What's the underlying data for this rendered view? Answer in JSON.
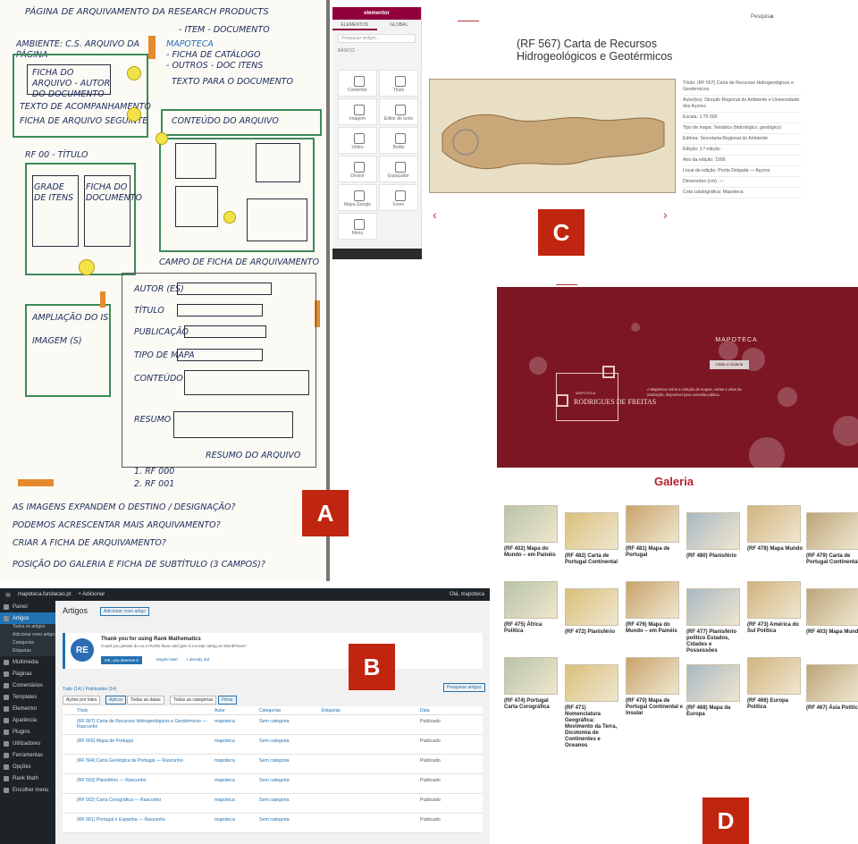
{
  "panel_letters": {
    "a": "A",
    "b": "B",
    "c": "C",
    "d": "D"
  },
  "colors": {
    "accent_red": "#c0260f",
    "mapoteca_bg": "#7d1623",
    "galeria_title": "#b2222c",
    "wp_dark": "#1d2327",
    "wp_blue": "#2271b1",
    "elementor_header": "#92003b",
    "sketch_green": "#3c8a5a",
    "sketch_orange": "#e58a2c"
  },
  "sketch": {
    "t1": "PÁGINA DE ARQUIVAMENTO DA RESEARCH PRODUCTS",
    "t2": "- ITEM - DOCUMENTO",
    "t3": "AMBIENTE: C.S. ARQUIVO DA PÁGINA",
    "t4": "MAPOTECA",
    "t5": "- FICHA DE CATÁLOGO",
    "t6": "- OUTROS - DOC ITENS",
    "t7": "FICHA DO ARQUIVO - AUTOR DO DOCUMENTO",
    "t8": "TEXTO DE ACOMPANHAMENTO",
    "t9": "FICHA DE ARQUIVO SEGUINTE",
    "t10": "TEXTO PARA O DOCUMENTO",
    "t11": "RF 00 - TÍTULO",
    "t12": "GRADE DE ITENS",
    "t13": "FICHA DO DOCUMENTO",
    "t14": "CONTEÚDO DO ARQUIVO",
    "t15": "AMPLIAÇÃO DO IS",
    "t16": "IMAGEM (S)",
    "t17": "AUTOR (ES)",
    "t18": "TÍTULO",
    "t19": "PUBLICAÇÃO",
    "t20": "TIPO DE MAPA",
    "t21": "CONTEÚDO",
    "t22": "RESUMO",
    "t23": "CAMPO DE FICHA DE ARQUIVAMENTO",
    "t24": "1. RF 000",
    "t25": "2. RF 001",
    "t26": "AS IMAGENS EXPANDEM O DESTINO / DESIGNAÇÃO?",
    "t27": "PODEMOS ACRESCENTAR MAIS ARQUIVAMENTO?",
    "t28": "CRIAR A FICHA DE ARQUIVAMENTO?",
    "t29": "RESUMO DO ARQUIVO",
    "t30": "POSIÇÃO DO GALERIA E FICHA DE SUBTÍTULO (3 CAMPOS)?"
  },
  "wp": {
    "top_site": "mapoteca.fundacao.pt",
    "top_new": "+ Adicionar",
    "top_user": "Olá, mapoteca",
    "page_title": "Artigos",
    "add_new": "Adicionar novo artigo",
    "notice_title": "Thank you for using Rank Mathematics",
    "notice_body": "Could you please do us a HUGE favor and give it a 5-star rating on WordPress?",
    "notice_btn": "OK, you deserve it",
    "notice_link1": "Maybe later",
    "notice_link2": "I already did",
    "filters": "Tudo (14) | Publicados (14)",
    "bulk": "Ações por lotes",
    "apply": "Aplicar",
    "all_dates": "Todas as datas",
    "all_cats": "Todas as categorias",
    "filter_btn": "Filtrar",
    "search_btn": "Pesquisar artigos",
    "col_title": "Título",
    "col_author": "Autor",
    "col_cats": "Categorias",
    "col_tags": "Etiquetas",
    "col_date": "Data",
    "rows": [
      {
        "title": "(RF 567) Carta de Recursos Hidrogeológicos e Geotérmicos — Rascunho",
        "author": "mapoteca",
        "cat": "Sem categoria",
        "status": "Publicado"
      },
      {
        "title": "(RF 565) Mapa de Portugal",
        "author": "mapoteca",
        "cat": "Sem categoria",
        "status": "Publicado"
      },
      {
        "title": "(RF 564) Carta Geológica de Portugal — Rascunho",
        "author": "mapoteca",
        "cat": "Sem categoria",
        "status": "Publicado"
      },
      {
        "title": "(RF 563) Planisfério — Rascunho",
        "author": "mapoteca",
        "cat": "Sem categoria",
        "status": "Publicado"
      },
      {
        "title": "(RF 562) Carta Corográfica — Rascunho",
        "author": "mapoteca",
        "cat": "Sem categoria",
        "status": "Publicado"
      },
      {
        "title": "(RF 561) Portugal e Espanha — Rascunho",
        "author": "mapoteca",
        "cat": "Sem categoria",
        "status": "Publicado"
      }
    ],
    "side_items": [
      "Painel",
      "Artigos",
      "Multimédia",
      "Páginas",
      "Comentários",
      "Templates",
      "Elementor",
      "Aparência",
      "Plugins",
      "Utilizadores",
      "Ferramentas",
      "Opções",
      "Rank Math",
      "Encolher menu"
    ],
    "side_sub": [
      "Todos os artigos",
      "Adicionar novo artigo",
      "Categorias",
      "Etiquetas"
    ]
  },
  "elementor": {
    "header": "elementor",
    "tab1": "ELEMENTOS",
    "tab2": "GLOBAL",
    "search": "Pesquisar widget...",
    "section": "BÁSICO",
    "widgets": [
      "Contentor",
      "Título",
      "Imagem",
      "Editor de texto",
      "Vídeo",
      "Botão",
      "Divisor",
      "Espaçador",
      "Mapa Google",
      "Ícone",
      "Menu",
      "Galeria"
    ]
  },
  "item_page": {
    "search_label": "Pesquisa",
    "title_l1": "(RF 567) Carta de Recursos",
    "title_l2": "Hidrogeológicos e Geotérmicos",
    "meta": [
      "Título: (RF 567) Carta de Recursos Hidrogeológicos e Geotérmicos",
      "Autor(es): Direção Regional do Ambiente e Universidade dos Açores",
      "Escala: 1:75 000",
      "Tipo de mapa: Temático (hidrológico, geológico)",
      "Editora: Secretaria Regional do Ambiente",
      "Edição: 1.ª edição",
      "Ano da edição: 1999",
      "Local de edição: Ponta Delgada — Açores",
      "Dimensões (cm): —",
      "Cota catalográfica: Mapoteca"
    ]
  },
  "landing": {
    "title": "MAPOTECA",
    "button": "Visite a Galeria",
    "brand_top": "MAPOTECA",
    "brand": "RODRIGUES DE FREITAS",
    "blurb": "A Mapoteca reúne a coleção de mapas, cartas e atlas da instituição, disponível para consulta pública."
  },
  "galeria": {
    "title": "Galeria",
    "items": [
      "(RF 402) Mapa do Mundo – em Painéis",
      "(RF 482) Carta de Portugal Continental",
      "(RF 481) Mapa de Portugal",
      "(RF 480) Planisfério",
      "(RF 478) Mapa Mundo",
      "(RF 479) Carta de Portugal Continental",
      "(RF 475) África Política",
      "(RF 472) Planisfério",
      "(RF 476) Mapa do Mundo – em Painéis",
      "(RF 477) Planisfério político Estados, Cidades e Possessões",
      "(RF 473) América do Sul Política",
      "(RF 403) Mapa Mundo",
      "(RF 474) Portugal Carta Corográfica",
      "(RF 471) Nomenclatura Geográfica: Movimento da Terra, Dicotomia de Continentes e Oceanos",
      "(RF 470) Mapa de Portugal Continental e Insular",
      "(RF 468) Mapa da Europa",
      "(RF 466) Europa Política",
      "(RF 467) Ásia Política"
    ]
  }
}
